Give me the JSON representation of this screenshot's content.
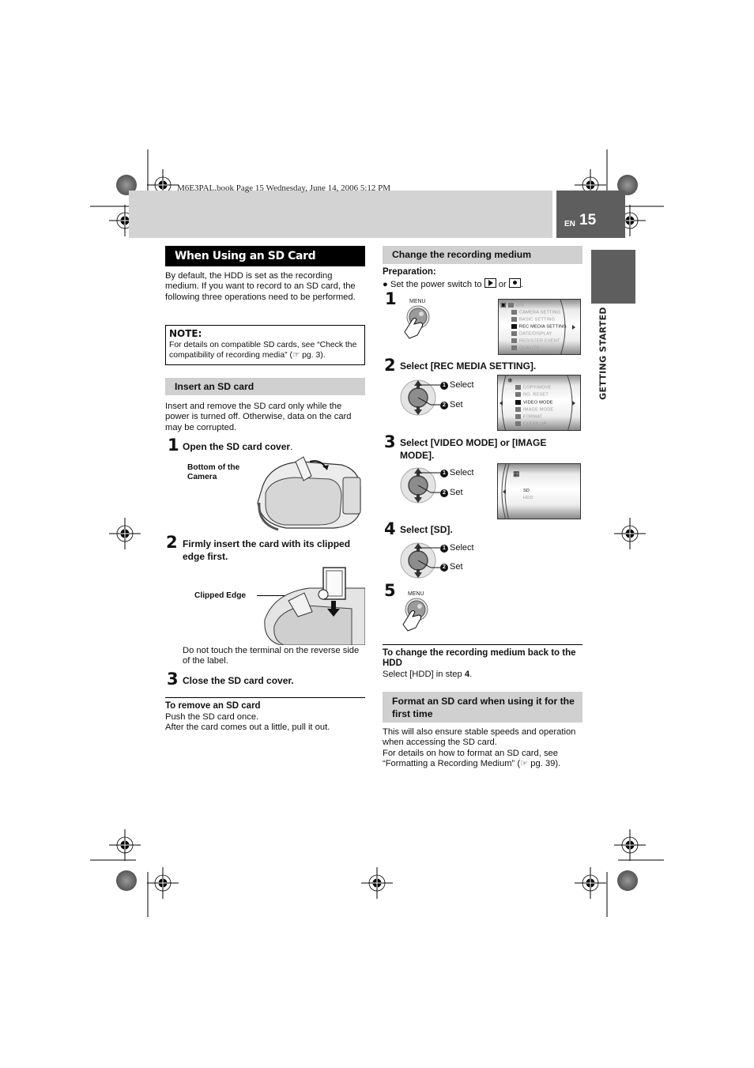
{
  "header": {
    "book_info": "M6E3PAL.book  Page 15  Wednesday, June 14, 2006  5:12 PM",
    "language": "EN",
    "page_number": "15",
    "section_tab": "GETTING STARTED"
  },
  "left": {
    "title": "When Using an SD Card",
    "intro": "By default, the HDD is set as the recording medium. If you want to record to an SD card, the following three operations need to be performed.",
    "note": {
      "title": "NOTE:",
      "text": "For details on compatible SD cards, see “Check the compatibility of recording media” (☞ pg. 3)."
    },
    "insert_heading": "Insert an SD card",
    "insert_text": "Insert and remove the SD card only while the power is turned off. Otherwise, data on the card may be corrupted.",
    "steps": [
      {
        "num": "1",
        "text": "Open the SD card cover",
        "suffix": ".",
        "caption": "Bottom of the Camera"
      },
      {
        "num": "2",
        "text": "Firmly insert the card with its clipped edge first.",
        "caption": "Clipped Edge",
        "note": "Do not touch the terminal on the reverse side of the label."
      },
      {
        "num": "3",
        "text": "Close the SD card cover."
      }
    ],
    "remove": {
      "title": "To remove an SD card",
      "line1": "Push the SD card once.",
      "line2": "After the card comes out a little, pull it out."
    }
  },
  "right": {
    "heading": "Change the recording medium",
    "preparation_label": "Preparation:",
    "preparation_text": "Set the power switch to",
    "preparation_or": "or",
    "menu_button_label": "MENU",
    "dial": {
      "select": "Select",
      "set": "Set",
      "n1": "1",
      "n2": "2"
    },
    "steps": [
      {
        "num": "1",
        "text": ""
      },
      {
        "num": "2",
        "text": "Select [REC MEDIA SETTING]."
      },
      {
        "num": "3",
        "text": "Select [VIDEO MODE] or [IMAGE MODE]."
      },
      {
        "num": "4",
        "text": "Select [SD]."
      },
      {
        "num": "5",
        "text": ""
      }
    ],
    "screen1": {
      "items": [
        {
          "label": "DIS",
          "selected": false
        },
        {
          "label": "CAMERA SETTING",
          "selected": false
        },
        {
          "label": "BASIC SETTING",
          "selected": false
        },
        {
          "label": "REC MEDIA SETTING",
          "selected": true
        },
        {
          "label": "DATE/DISPLAY",
          "selected": false
        },
        {
          "label": "REGISTER EVENT",
          "selected": false
        },
        {
          "label": "QUALITY",
          "selected": false
        }
      ]
    },
    "screen2": {
      "items": [
        {
          "label": "COPY/MOVE",
          "selected": false
        },
        {
          "label": "NO. RESET",
          "selected": false
        },
        {
          "label": "VIDEO MODE",
          "selected": true
        },
        {
          "label": "IMAGE MODE",
          "selected": false
        },
        {
          "label": "FORMAT",
          "selected": false
        },
        {
          "label": "CLEAN UP",
          "selected": false
        }
      ]
    },
    "screen3": {
      "items": [
        {
          "label": "SD",
          "selected": true
        },
        {
          "label": "HDD",
          "selected": false
        }
      ]
    },
    "back_to_hdd": {
      "title": "To change the recording medium back to the HDD",
      "text_pre": "Select [HDD] in step ",
      "text_step": "4",
      "text_post": "."
    },
    "format_heading": "Format an SD card when using it for the first time",
    "format_text1": "This will also ensure stable speeds and operation when accessing the SD card.",
    "format_text2": "For details on how to format an SD card, see “Formatting a Recording Medium” (☞ pg. 39)."
  }
}
